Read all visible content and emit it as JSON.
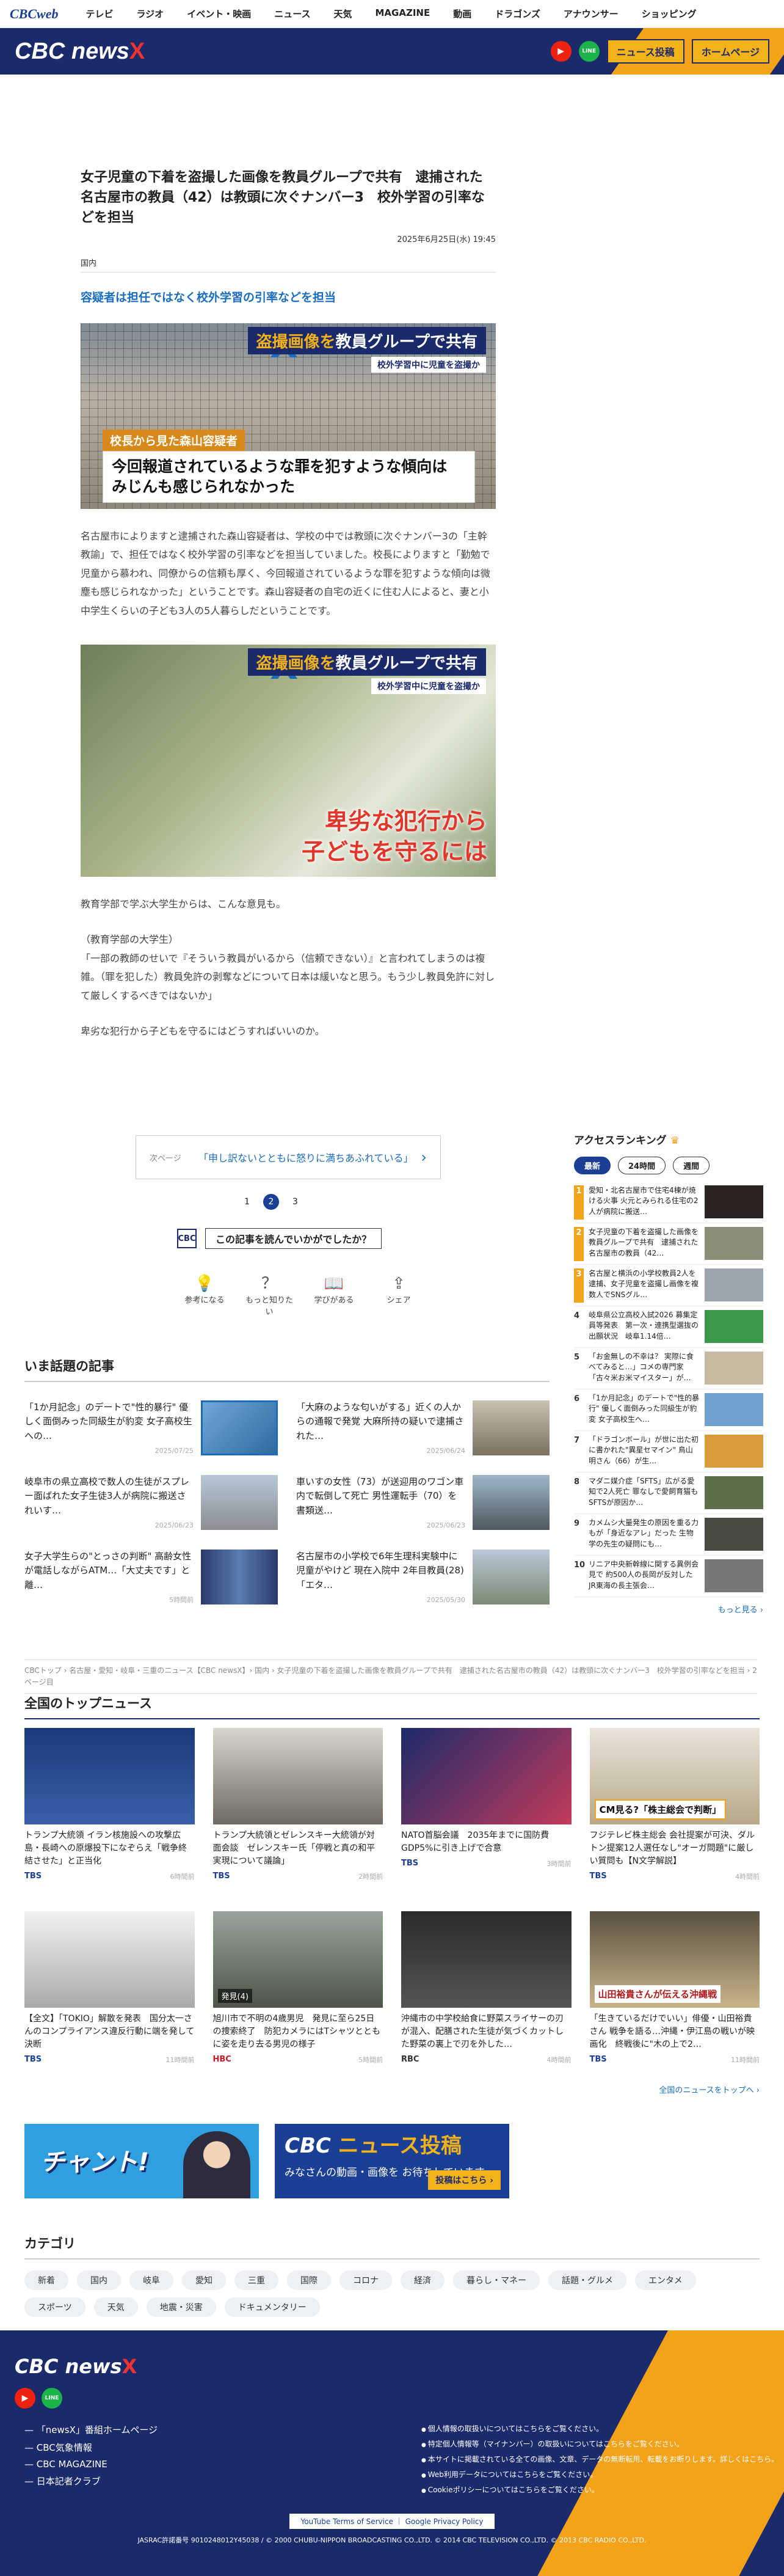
{
  "topnav": {
    "logo": "CBCweb",
    "items": [
      "テレビ",
      "ラジオ",
      "イベント・映画",
      "ニュース",
      "天気",
      "MAGAZINE",
      "動画",
      "ドラゴンズ",
      "アナウンサー",
      "ショッピング"
    ]
  },
  "band": {
    "brand_main": "CBC news",
    "brand_x": "X",
    "yt": "▶",
    "line": "LINE",
    "btn1": "ニュース投稿",
    "btn2": "ホームページ"
  },
  "article": {
    "headline": "女子児童の下着を盗撮した画像を教員グループで共有　逮捕された名古屋市の教員（42）は教頭に次ぐナンバー3　校外学習の引率などを担当",
    "date": "2025年6月25日(水) 19:45",
    "category": "国内",
    "subhead": "容疑者は担任ではなく校外学習の引率などを担当",
    "photo1": {
      "cap_main_a": "盗撮画像を",
      "cap_main_b": "教員グループで共有",
      "cap_sub": "校外学習中に児童を盗撮か",
      "tag": "校長から見た森山容疑者",
      "tele": "今回報道されているような罪を犯すような傾向は みじんも感じられなかった"
    },
    "p1": "名古屋市によりますと逮捕された森山容疑者は、学校の中では教頭に次ぐナンバー3の「主幹教諭」で、担任ではなく校外学習の引率などを担当していました。校長によりますと「勤勉で児童から慕われ、同僚からの信頼も厚く、今回報道されているような罪を犯すような傾向は微塵も感じられなかった」ということです。森山容疑者の自宅の近くに住む人によると、妻と小中学生くらいの子ども3人の5人暮らしだということです。",
    "photo2": {
      "cap_main_a": "盗撮画像を",
      "cap_main_b": "教員グループで共有",
      "cap_sub": "校外学習中に児童を盗撮か",
      "red1": "卑劣な犯行から",
      "red2": "子どもを守るには"
    },
    "p2": "教育学部で学ぶ大学生からは、こんな意見も。",
    "p3a": "（教育学部の大学生）",
    "p3b": "「一部の教師のせいで『そういう教員がいるから（信頼できない）』と言われてしまうのは複雑。（罪を犯した）教員免許の剥奪などについて日本は緩いなと思う。もう少し教員免許に対して厳しくするべきではないか」",
    "p4": "卑劣な犯行から子どもを守るにはどうすればいいのか。"
  },
  "nextpage": {
    "label": "次ページ",
    "title": "「申し訳ないとともに怒りに満ちあふれている」"
  },
  "pager": [
    "1",
    "2",
    "3"
  ],
  "feedback": {
    "icon": "CBC",
    "question": "この記事を読んでいかがでしたか？"
  },
  "reactions": [
    {
      "icon": "💡",
      "label": "参考になる"
    },
    {
      "icon": "？",
      "label": "もっと知りたい"
    },
    {
      "icon": "📖",
      "label": "学びがある"
    },
    {
      "icon": "⇪",
      "label": "シェア"
    }
  ],
  "wadai": {
    "title": "いま話題の記事",
    "items": [
      {
        "text": "「1か月記念」のデートで\"性的暴行\" 優しく面倒みった同級生が豹変 女子高校生への…",
        "date": "2025/07/25"
      },
      {
        "text": "「大麻のような匂いがする」近くの人からの通報で発覚 大麻所持の疑いで逮捕された…",
        "date": "2025/06/24"
      },
      {
        "text": "岐阜市の県立高校で数人の生徒がスプレー面ばれた女子生徒3人が病院に搬送されいす…",
        "date": "2025/06/23"
      },
      {
        "text": "車いすの女性（73）が送迎用のワゴン車内で転倒して死亡 男性運転手（70）を書類送…",
        "date": "2025/06/23"
      },
      {
        "text": "女子大学生らの\"とっさの判断\" 高齢女性が電話しながらATM…「大丈夫です」と離…",
        "date": "5時間前"
      },
      {
        "text": "名古屋市の小学校で6年生理科実験中に児童がやけど 現在入院中 2年目教員(28)「エタ…",
        "date": "2025/05/30"
      }
    ]
  },
  "ranking": {
    "title": "アクセスランキング",
    "tabs": [
      "最新",
      "24時間",
      "週間"
    ],
    "items": [
      {
        "n": "1",
        "text": "愛知・北名古屋市で住宅4棟が焼ける火事 火元とみられる住宅の2人が病院に搬送…"
      },
      {
        "n": "2",
        "text": "女子児童の下着を盗撮した画像を教員グループで共有　逮捕された名古屋市の教員（42…"
      },
      {
        "n": "3",
        "text": "名古屋と横浜の小学校教員2人を逮捕、女子児童を盗撮し画像を複数人でSNSグル…"
      },
      {
        "n": "4",
        "text": "岐阜県公立高校入試2026 募集定員等発表　第一次・連携型選抜の出願状況　岐阜1.14倍…"
      },
      {
        "n": "5",
        "text": "「お金無しの不幸は？ 実際に食べてみると…」コメの専門家「古々米お米マイスター」が…"
      },
      {
        "n": "6",
        "text": "「1か月記念」のデートで\"性的暴行\" 優しく面倒みった同級生が豹変 女子高校生へ…"
      },
      {
        "n": "7",
        "text": "「ドラゴンボール」が世に出た初に書かれた\"異星セマイン\" 鳥山明さん（66）が生…"
      },
      {
        "n": "8",
        "text": "マダニ媒介症「SFTS」広がる愛知で2人死亡 罪なしで愛飼育猫もSFTSが原因か…"
      },
      {
        "n": "9",
        "text": "カメムシ大量発生の原因を重る力もが「身近なアレ」だった 生物学の先生の疑問にも…"
      },
      {
        "n": "10",
        "text": "リニア中央新幹線に関する異例会見で 約500人の長岡が反対した JR東海の長主張会…"
      }
    ],
    "more": "もっと見る ›"
  },
  "breadcrumb": "CBCトップ › 名古屋・愛知・岐阜・三重のニュース【CBC newsX】› 国内 › 女子児童の下着を盗撮した画像を教員グループで共有　逮捕された名古屋市の教員（42）は教頭に次ぐナンバー3　校外学習の引率などを担当 › 2ページ目",
  "zenkoku": {
    "title": "全国のトップニュース",
    "items": [
      {
        "text": "トランプ大統領 イラン核施設への攻撃広島・長崎への原爆投下になぞらえ「戦争終結させた」と正当化",
        "src": "TBS",
        "time": "6時間前"
      },
      {
        "text": "トランプ大統領とゼレンスキー大統領が対面会談　ゼレンスキー氏「停戦と真の和平実現について議論」",
        "src": "TBS",
        "time": "2時間前"
      },
      {
        "text": "NATO首脳会議　2035年までに国防費GDP5%に引き上げで合意",
        "src": "TBS",
        "time": "3時間前"
      },
      {
        "text": "フジテレビ株主総会 会社提案が可決、ダルトン提案12人選任なし\"オーガ問題\"に厳しい質問も【N文学解説】",
        "src": "TBS",
        "time": "4時間前"
      },
      {
        "text": "【全文】「TOKIO」解散を発表　国分太一さんのコンプライアンス違反行動に端を発して決断",
        "src": "TBS",
        "time": "11時間前"
      },
      {
        "text": "旭川市で不明の4歳男児　発見に至ら25日の捜索終了　防犯カメラにはTシャツとともに姿を走り去る男児の様子",
        "src": "HBC",
        "time": "5時間前"
      },
      {
        "text": "沖縄市の中学校給食に野菜スライサーの刃が混入、配膳された生徒が気づくカットした野菜の裏上で刃を外した…",
        "src": "RBC",
        "time": "4時間前"
      },
      {
        "text": "「生きているだけでいい」俳優・山田裕貴さん 戦争を語る…沖縄・伊江島の戦いが映画化　終戦後に\"木の上で2…",
        "src": "TBS",
        "time": "11時間前"
      }
    ],
    "img_caps": [
      "",
      "",
      "",
      "CM見る?「株主総会で判断」",
      "",
      "発見(4)",
      "",
      "山田裕貴さんが伝える沖縄戦"
    ],
    "more": "全国のニュースをトップへ ›"
  },
  "banners": {
    "b1": "チャント!",
    "b2_title_a": "CBC",
    "b2_title_b": "ニュース投稿",
    "b2_sub": "みなさんの動画・画像を お待ちしています。",
    "b2_btn": "投稿はこちら ›"
  },
  "categories": {
    "title": "カテゴリ",
    "items": [
      "新着",
      "国内",
      "岐阜",
      "愛知",
      "三重",
      "国際",
      "コロナ",
      "経済",
      "暮らし・マネー",
      "話題・グルメ",
      "エンタメ",
      "スポーツ",
      "天気",
      "地震・災害",
      "ドキュメンタリー"
    ]
  },
  "footer": {
    "links": [
      "「newsX」番組ホームページ",
      "CBC気象情報",
      "CBC MAGAZINE",
      "日本記者クラブ"
    ],
    "links2": [
      "個人情報の取扱いについてはこちらをご覧ください。",
      "特定個人情報等（マイナンバー）の取扱いについてはこちらをご覧ください。",
      "本サイトに掲載されている全ての画像、文章、データの無断転用、転載をお断りします。詳しくはこちら。",
      "Web利用データについてはこちらをご覧ください。",
      "Cookieポリシーについてはこちらをご覧ください。"
    ],
    "policy": "YouTube Terms of Service ｜ Google Privacy Policy",
    "copyright": "JASRAC許諾番号 9010248012Y45038 / © 2000 CHUBU-NIPPON BROADCASTING CO.,LTD. © 2014 CBC TELEVISION CO.,LTD. © 2013 CBC RADIO CO.,LTD."
  },
  "colors": {
    "navy": "#1b2a6b",
    "orange": "#f4a21a",
    "blue": "#1a6dbd",
    "red": "#e3362a"
  }
}
